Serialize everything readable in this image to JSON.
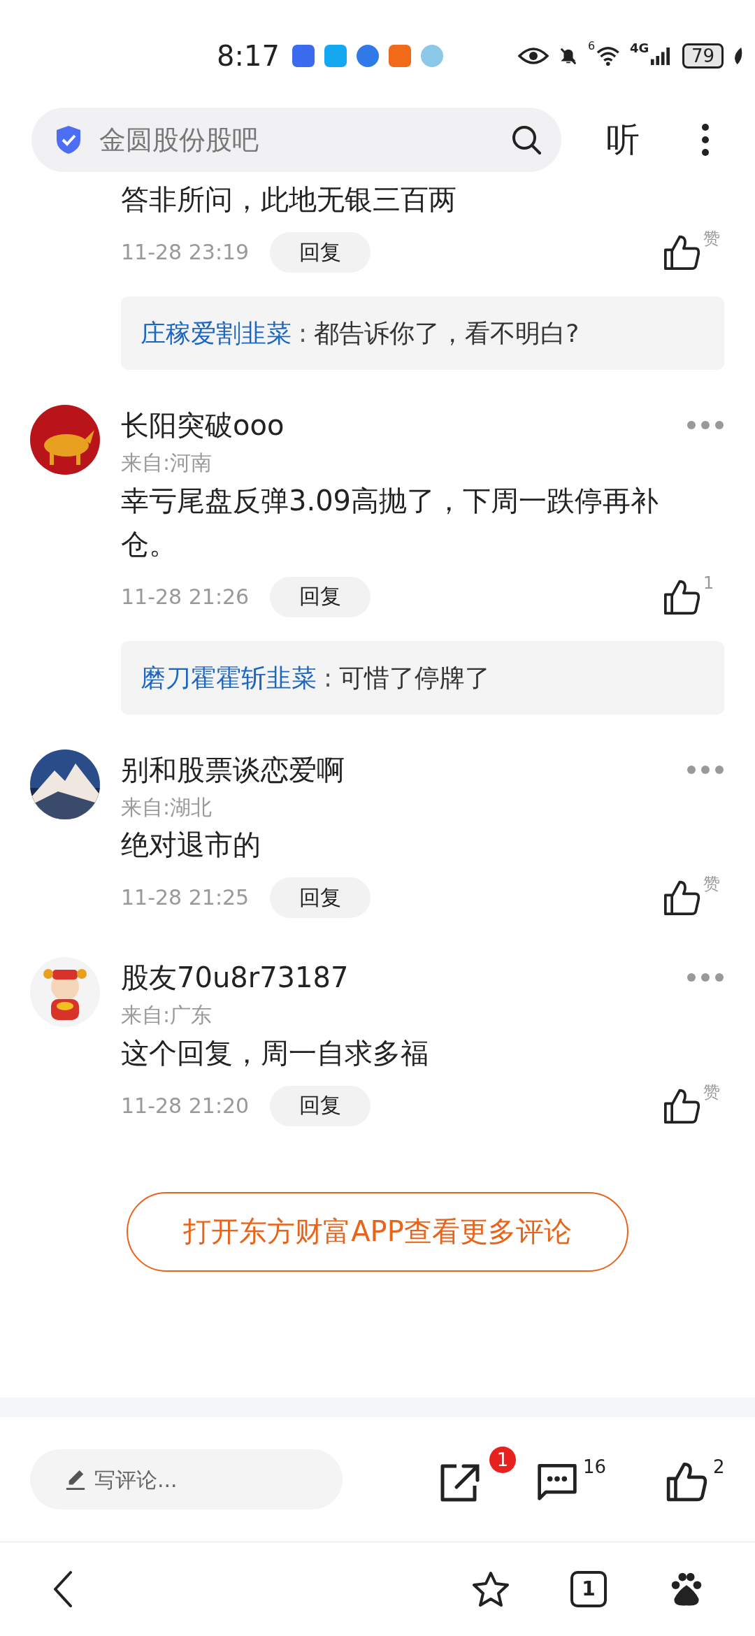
{
  "status_bar": {
    "time": "8:17",
    "signal_label": "6",
    "network": "4G",
    "battery": "79"
  },
  "header": {
    "search_text": "金圆股份股吧",
    "listen_label": "听"
  },
  "comments": [
    {
      "content": "答非所问，此地无银三百两",
      "time": "11-28 23:19",
      "reply_label": "回复",
      "likes": "赞",
      "replies": [
        {
          "author": "庄稼爱割韭菜",
          "separator": ":",
          "text": "都告诉你了，看不明白?"
        }
      ]
    },
    {
      "author": "长阳突破ooo",
      "location": "来自:河南",
      "content": "幸亏尾盘反弹3.09高抛了，下周一跌停再补仓。",
      "time": "11-28 21:26",
      "reply_label": "回复",
      "likes": "1",
      "replies": [
        {
          "author": "磨刀霍霍斩韭菜",
          "separator": ":",
          "text": "可惜了停牌了"
        }
      ]
    },
    {
      "author": "别和股票谈恋爱啊",
      "location": "来自:湖北",
      "content": "绝对退市的",
      "time": "11-28 21:25",
      "reply_label": "回复",
      "likes": "赞"
    },
    {
      "author": "股友70u8r73187",
      "location": "来自:广东",
      "content": "这个回复，周一自求多福",
      "time": "11-28 21:20",
      "reply_label": "回复",
      "likes": "赞"
    }
  ],
  "more_button": "打开东方财富APP查看更多评论",
  "action_bar": {
    "comment_placeholder": "写评论...",
    "share_badge": "1",
    "comment_count": "16",
    "like_count": "2"
  },
  "nav_bar": {
    "tab_count": "1"
  }
}
